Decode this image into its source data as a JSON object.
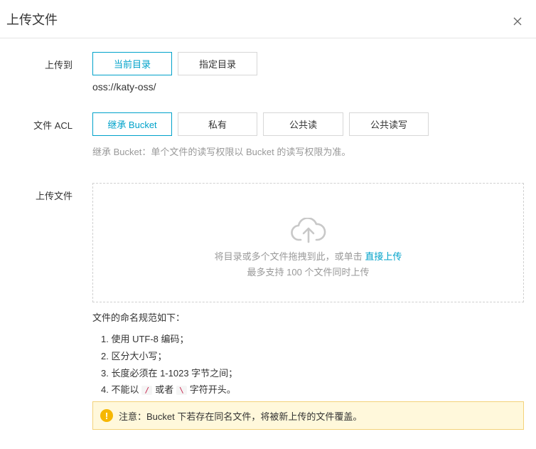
{
  "dialog": {
    "title": "上传文件",
    "close_icon": "close-icon"
  },
  "upload_to": {
    "label": "上传到",
    "options": [
      "当前目录",
      "指定目录"
    ],
    "selected": "当前目录",
    "path": "oss://katy-oss/"
  },
  "acl": {
    "label": "文件 ACL",
    "options": [
      "继承 Bucket",
      "私有",
      "公共读",
      "公共读写"
    ],
    "selected": "继承 Bucket",
    "hint": "继承 Bucket：单个文件的读写权限以 Bucket 的读写权限为准。"
  },
  "upload_file": {
    "label": "上传文件",
    "icon": "cloud-upload-icon",
    "drop_text": "将目录或多个文件拖拽到此，或单击",
    "direct_upload_link": "直接上传",
    "limit_text": "最多支持 100 个文件同时上传"
  },
  "naming_rules": {
    "title": "文件的命名规范如下：",
    "rule1": "1. 使用 UTF-8 编码；",
    "rule2": "2. 区分大小写；",
    "rule3": "3. 长度必须在 1-1023 字节之间；",
    "rule4_prefix": "4. 不能以",
    "rule4_code1": "/",
    "rule4_middle": "或者",
    "rule4_code2": "\\",
    "rule4_suffix": "字符开头。"
  },
  "notice": {
    "icon": "warning-icon",
    "text": "注意：Bucket 下若存在同名文件，将被新上传的文件覆盖。"
  },
  "colors": {
    "accent": "#00a2ca",
    "warning_bg": "#fff8db",
    "warning_icon": "#f6b700"
  }
}
